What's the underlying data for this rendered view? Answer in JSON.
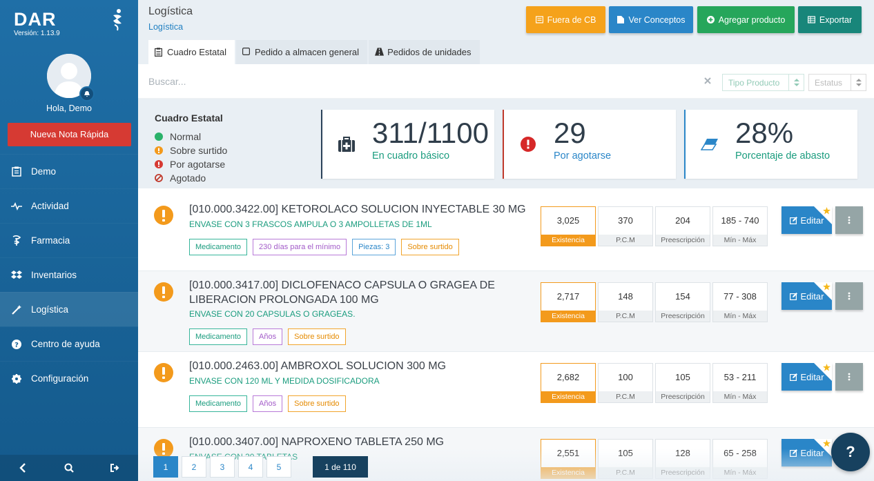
{
  "app": {
    "brand": "DAR",
    "version": "Versión: 1.13.9",
    "greeting": "Hola, Demo",
    "quick_note": "Nueva Nota Rápida"
  },
  "sidebar": {
    "items": [
      {
        "label": "Demo",
        "icon": "clipboard-icon"
      },
      {
        "label": "Actividad",
        "icon": "pulse-icon"
      },
      {
        "label": "Farmacia",
        "icon": "pharmacy-icon"
      },
      {
        "label": "Inventarios",
        "icon": "dropbox-icon"
      },
      {
        "label": "Logística",
        "icon": "magic-wand-icon",
        "active": true
      },
      {
        "label": "Centro de ayuda",
        "icon": "question-circle-icon"
      },
      {
        "label": "Configuración",
        "icon": "gear-icon"
      }
    ]
  },
  "header": {
    "title": "Logística",
    "breadcrumb": "Logística",
    "buttons": {
      "fuera_cb": "Fuera de CB",
      "ver_conceptos": "Ver Conceptos",
      "agregar_producto": "Agregar producto",
      "exportar": "Exportar"
    },
    "tabs": [
      {
        "label": "Cuadro Estatal",
        "active": true
      },
      {
        "label": "Pedido a almacen general"
      },
      {
        "label": "Pedidos de unidades"
      }
    ]
  },
  "search": {
    "placeholder": "Buscar...",
    "tipo_producto": "Tipo Producto",
    "estatus": "Estatus"
  },
  "legend": {
    "title": "Cuadro Estatal",
    "items": [
      {
        "label": "Normal",
        "color": "#2ab26a"
      },
      {
        "label": "Sobre surtido",
        "color": "#f39a1c"
      },
      {
        "label": "Por agotarse",
        "color": "#d63a33"
      },
      {
        "label": "Agotado",
        "color": "#c0392b"
      }
    ]
  },
  "stats": [
    {
      "value": "311/1100",
      "label": "En cuadro básico"
    },
    {
      "value": "29",
      "label": "Por agotarse"
    },
    {
      "value": "28%",
      "label": "Porcentaje de abasto"
    }
  ],
  "metric_labels": {
    "existencia": "Existencia",
    "pcm": "P.C.M",
    "prescripcion": "Preescripción",
    "minmax": "Mín - Máx"
  },
  "edit_label": "Editar",
  "products": [
    {
      "title": "[010.000.3422.00] KETOROLACO SOLUCION INYECTABLE 30 MG",
      "subtitle": "ENVASE CON 3 FRASCOS AMPULA O 3 AMPOLLETAS DE 1ML",
      "tags": [
        {
          "label": "Medicamento",
          "color": "green"
        },
        {
          "label": "230 días para el mínimo",
          "color": "purple"
        },
        {
          "label": "Piezas: 3",
          "color": "blue"
        },
        {
          "label": "Sobre surtido",
          "color": "orange"
        }
      ],
      "existencia": "3,025",
      "pcm": "370",
      "prescripcion": "204",
      "minmax": "185 - 740"
    },
    {
      "title": "[010.000.3417.00] DICLOFENACO CAPSULA O GRAGEA DE LIBERACION PROLONGADA 100 MG",
      "subtitle": "ENVASE CON 20 CAPSULAS O GRAGEAS.",
      "tags": [
        {
          "label": "Medicamento",
          "color": "green"
        },
        {
          "label": "Años",
          "color": "purple"
        },
        {
          "label": "Sobre surtido",
          "color": "orange"
        }
      ],
      "existencia": "2,717",
      "pcm": "148",
      "prescripcion": "154",
      "minmax": "77 - 308"
    },
    {
      "title": "[010.000.2463.00] AMBROXOL SOLUCION 300 MG",
      "subtitle": "ENVASE CON 120 ML Y MEDIDA DOSIFICADORA",
      "tags": [
        {
          "label": "Medicamento",
          "color": "green"
        },
        {
          "label": "Años",
          "color": "purple"
        },
        {
          "label": "Sobre surtido",
          "color": "orange"
        }
      ],
      "existencia": "2,682",
      "pcm": "100",
      "prescripcion": "105",
      "minmax": "53 - 211"
    },
    {
      "title": "[010.000.3407.00] NAPROXENO TABLETA 250 MG",
      "subtitle": "ENVASE CON 30 TABLETAS",
      "tags": [],
      "existencia": "2,551",
      "pcm": "105",
      "prescripcion": "128",
      "minmax": "65 - 258"
    }
  ],
  "pagination": {
    "pages": [
      "1",
      "2",
      "3",
      "4",
      "5"
    ],
    "active": "1",
    "info": "1 de 110"
  },
  "help": "?"
}
